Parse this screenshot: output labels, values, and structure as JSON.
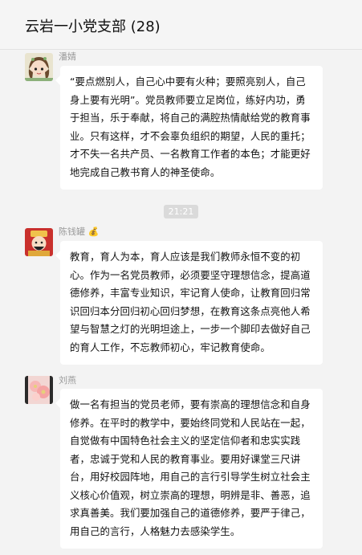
{
  "header": {
    "title": "云岩一小党支部 (28)"
  },
  "timestamp": "21:21",
  "messages": [
    {
      "sender": "潘婧",
      "text": "“要点燃别人，自己心中要有火种；要照亮别人，自己身上要有光明”。党员教师要立足岗位，练好内功，勇于担当，乐于奉献，将自己的满腔热情献给党的教育事业。只有这样，才不会辜负组织的期望，人民的重托；才不失一名共产员、一名教育工作者的本色；才能更好地完成自己教书育人的神圣使命。"
    },
    {
      "sender": "陈钱罐",
      "sender_suffix_icon": "money-bag-icon",
      "text": "教育，育人为本，育人应该是我们教师永恒不变的初心。作为一名党员教师，必须要坚守理想信念，提高道德修养，丰富专业知识，牢记育人使命，让教育回归常识回归本分回归初心回归梦想，在教育这条点亮他人希望与智慧之灯的光明坦途上，一步一个脚印去做好自己的育人工作，不忘教师初心，牢记教育使命。"
    },
    {
      "sender": "刘燕",
      "text": "做一名有担当的党员老师，要有崇高的理想信念和自身修养。在平时的教学中，要始终同党和人民站在一起，自觉做有中国特色社会主义的坚定信仰者和忠实实践者，忠诚于党和人民的教育事业。要用好课堂三尺讲台，用好校园阵地，用自己的言行引导学生树立社会主义核心价值观，树立崇高的理想，明辨是非、善恶，追求真善美。我们要加强自己的道德修养，要严于律己，用自己的言行，人格魅力去感染学生。"
    }
  ]
}
